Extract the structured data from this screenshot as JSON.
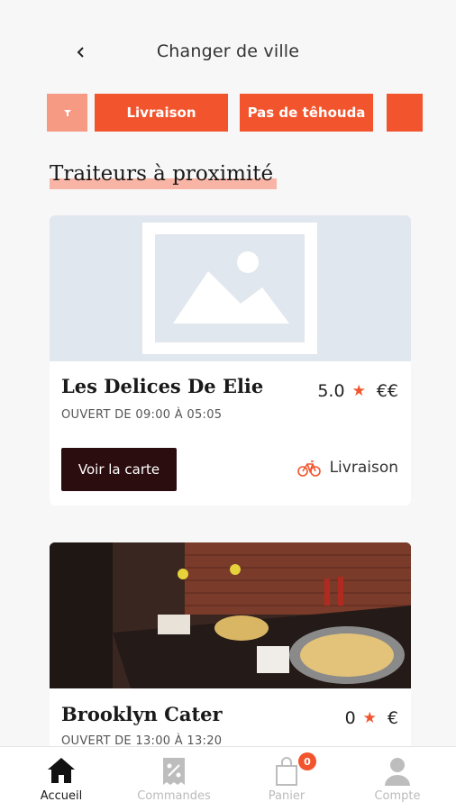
{
  "header": {
    "title": "Changer de ville"
  },
  "filters": {
    "chips": [
      "Livraison",
      "Pas de têhouda"
    ]
  },
  "section": {
    "title": "Traiteurs à proximité"
  },
  "restaurants": [
    {
      "name": "Les Delices De Elie",
      "hours": "OUVERT DE 09:00 À 05:05",
      "rating": "5.0",
      "price": "€€",
      "menu_label": "Voir la carte",
      "delivery_label": "Livraison"
    },
    {
      "name": "Brooklyn Cater",
      "hours": "OUVERT DE 13:00 À 13:20",
      "rating": "0",
      "price": "€"
    }
  ],
  "nav": {
    "items": [
      "Accueil",
      "Commandes",
      "Panier",
      "Compte"
    ],
    "cart_count": "0"
  },
  "colors": {
    "accent": "#f2542d",
    "dark": "#2b0d0f"
  }
}
